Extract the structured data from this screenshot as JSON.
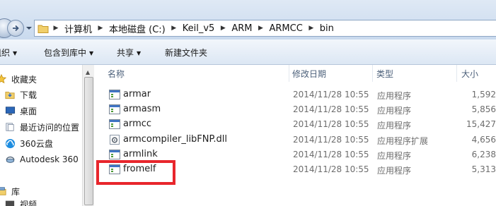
{
  "address_bar": {
    "crumbs": [
      "计算机",
      "本地磁盘 (C:)",
      "Keil_v5",
      "ARM",
      "ARMCC",
      "bin"
    ],
    "separator": "▶"
  },
  "toolbar": {
    "organize_label": "组织",
    "include_label": "包含到库中",
    "share_label": "共享",
    "new_folder_label": "新建文件夹"
  },
  "navigation": {
    "favorites_label": "收藏夹",
    "items": [
      {
        "label": "下载",
        "icon": "download-folder-icon"
      },
      {
        "label": "桌面",
        "icon": "desktop-icon"
      },
      {
        "label": "最近访问的位置",
        "icon": "recent-places-icon"
      },
      {
        "label": "360云盘",
        "icon": "cloud-drive-icon"
      },
      {
        "label": "Autodesk 360",
        "icon": "autodesk-360-icon"
      }
    ],
    "libraries_label": "库",
    "partial_label": "视频"
  },
  "columns": {
    "name": "名称",
    "date": "修改日期",
    "type": "类型",
    "size": "大小"
  },
  "files": [
    {
      "name": "armar",
      "date": "2014/11/28 10:55",
      "type": "应用程序",
      "size": "1,592",
      "icon": "application-icon"
    },
    {
      "name": "armasm",
      "date": "2014/11/28 10:55",
      "type": "应用程序",
      "size": "5,856",
      "icon": "application-icon"
    },
    {
      "name": "armcc",
      "date": "2014/11/28 10:55",
      "type": "应用程序",
      "size": "15,427",
      "icon": "application-icon"
    },
    {
      "name": "armcompiler_libFNP.dll",
      "date": "2014/11/28 10:55",
      "type": "应用程序扩展",
      "size": "4,656",
      "icon": "dll-gear-icon"
    },
    {
      "name": "armlink",
      "date": "2014/11/28 10:55",
      "type": "应用程序",
      "size": "6,238",
      "icon": "application-icon"
    },
    {
      "name": "fromelf",
      "date": "2014/11/28 10:55",
      "type": "应用程序",
      "size": "5,313",
      "icon": "application-icon"
    }
  ],
  "colors": {
    "highlight": "#e8262c",
    "header_text": "#4c607a",
    "toolbar_top": "#f2f6fb",
    "toolbar_bottom": "#dce7f4"
  }
}
